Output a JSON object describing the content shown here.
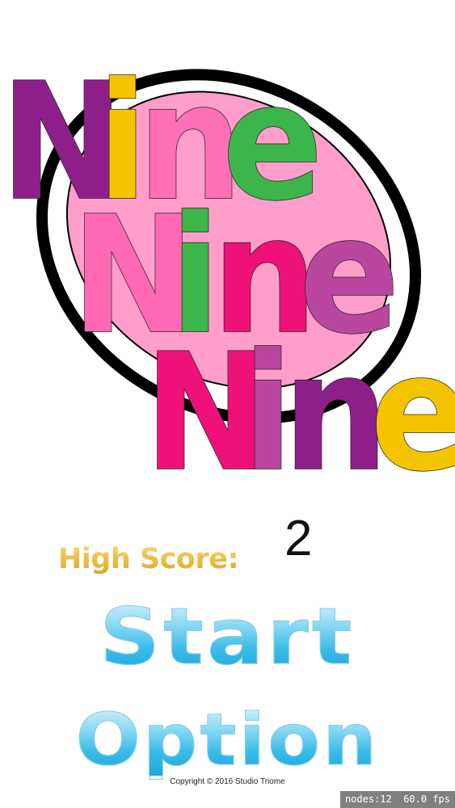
{
  "logo": {
    "lines": [
      {
        "letters": [
          {
            "char": "N",
            "color": "#8e1f8a"
          },
          {
            "char": "i",
            "color": "#f5c400"
          },
          {
            "char": "n",
            "color": "#ff6fb5"
          },
          {
            "char": "e",
            "color": "#3cb54a"
          }
        ]
      },
      {
        "letters": [
          {
            "char": "N",
            "color": "#ff69b4"
          },
          {
            "char": "i",
            "color": "#3cb54a"
          },
          {
            "char": "n",
            "color": "#ee1177"
          },
          {
            "char": "e",
            "color": "#b9479f"
          }
        ]
      },
      {
        "letters": [
          {
            "char": "N",
            "color": "#ee1177"
          },
          {
            "char": "i",
            "color": "#b9479f"
          },
          {
            "char": "n",
            "color": "#8e1f8a"
          },
          {
            "char": "e",
            "color": "#f5c400"
          }
        ]
      }
    ],
    "ellipse_fill": "#ff9ecb",
    "ellipse_ring": "#000000"
  },
  "high_score": {
    "label": "High Score:",
    "value": "2",
    "label_color": "#e8c34f"
  },
  "menu": {
    "start_label": "Start",
    "option_label": "Option",
    "button_color": "#3cbde8"
  },
  "footer": {
    "copyright": "Copyright © 2016 Studio Triome"
  },
  "debug": {
    "nodes_text": "nodes:12",
    "fps_text": "60.0 fps"
  }
}
